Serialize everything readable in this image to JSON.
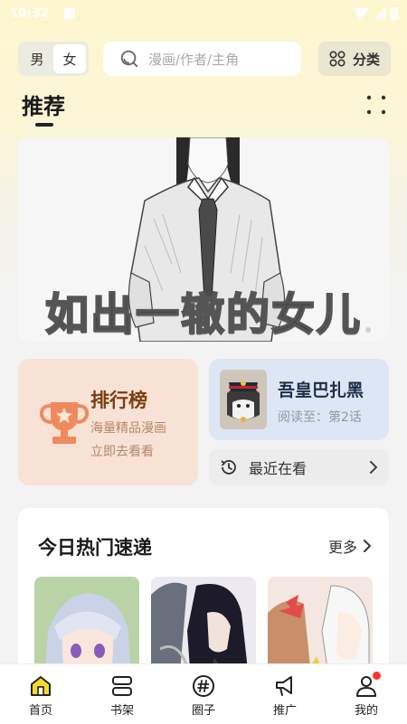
{
  "status_bar": {
    "time": "10:32"
  },
  "header": {
    "gender_options": [
      "男",
      "女"
    ],
    "gender_selected": "女",
    "search_placeholder": "漫画/作者/主角",
    "category_label": "分类"
  },
  "recommend": {
    "title": "推荐",
    "banner_title": "如出一辙的女儿"
  },
  "ranking": {
    "title": "排行榜",
    "subtitle1": "海量精品漫画",
    "subtitle2": "立即去看看"
  },
  "continue_reading": {
    "title": "吾皇巴扎黑",
    "progress": "阅读至：第2话"
  },
  "recent": {
    "label": "最近在看"
  },
  "hot": {
    "title": "今日热门速递",
    "more_label": "更多"
  },
  "bottom_nav": [
    {
      "label": "首页",
      "icon": "home-icon",
      "active": true
    },
    {
      "label": "书架",
      "icon": "bookshelf-icon"
    },
    {
      "label": "圈子",
      "icon": "hashtag-icon"
    },
    {
      "label": "推广",
      "icon": "megaphone-icon"
    },
    {
      "label": "我的",
      "icon": "profile-icon",
      "badge": true
    }
  ],
  "colors": {
    "accent_yellow": "#f7d92a",
    "rank_bg": "#f8e2d5",
    "trophy": "#f08a5d",
    "read_bg": "#dde6f4",
    "badge_red": "#ff3333"
  }
}
